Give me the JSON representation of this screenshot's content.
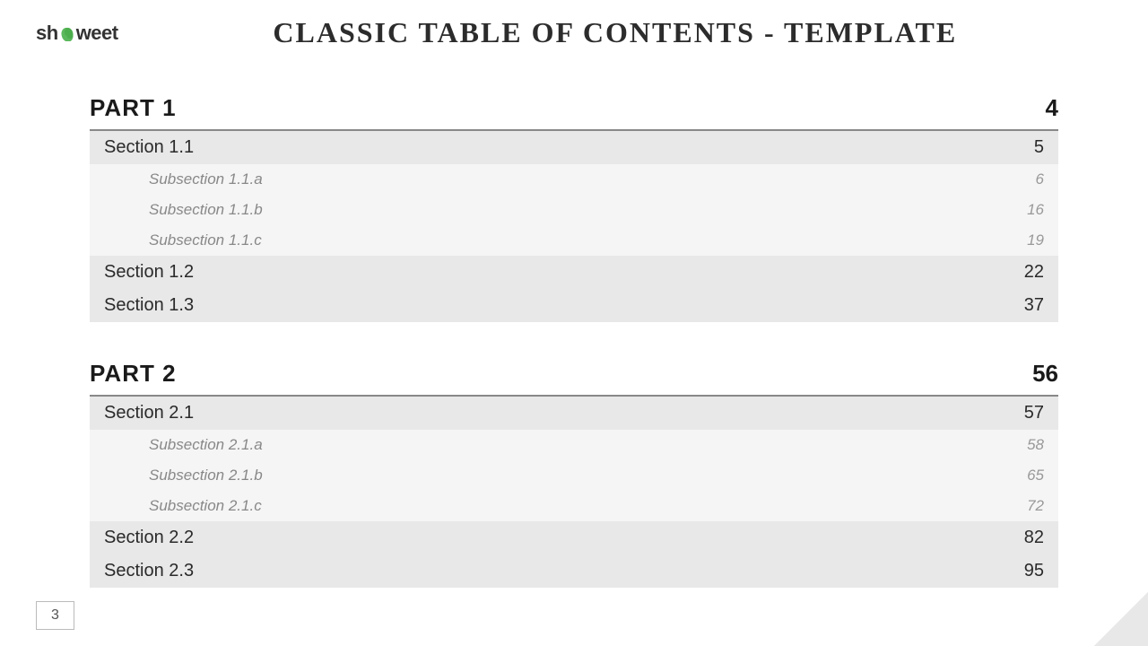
{
  "header": {
    "logo": "sh🌿weet",
    "title": "Classic Table of Contents - Template"
  },
  "toc": {
    "parts": [
      {
        "label": "PART 1",
        "page": "4",
        "sections": [
          {
            "type": "section",
            "label": "Section 1.1",
            "page": "5",
            "subsections": [
              {
                "label": "Subsection 1.1.a",
                "page": "6"
              },
              {
                "label": "Subsection 1.1.b",
                "page": "16"
              },
              {
                "label": "Subsection 1.1.c",
                "page": "19"
              }
            ]
          },
          {
            "type": "section",
            "label": "Section 1.2",
            "page": "22",
            "subsections": []
          },
          {
            "type": "section",
            "label": "Section 1.3",
            "page": "37",
            "subsections": []
          }
        ]
      },
      {
        "label": "PART 2",
        "page": "56",
        "sections": [
          {
            "type": "section",
            "label": "Section 2.1",
            "page": "57",
            "subsections": [
              {
                "label": "Subsection 2.1.a",
                "page": "58"
              },
              {
                "label": "Subsection 2.1.b",
                "page": "65"
              },
              {
                "label": "Subsection 2.1.c",
                "page": "72"
              }
            ]
          },
          {
            "type": "section",
            "label": "Section 2.2",
            "page": "82",
            "subsections": []
          },
          {
            "type": "section",
            "label": "Section 2.3",
            "page": "95",
            "subsections": []
          }
        ]
      }
    ]
  },
  "page_number": "3"
}
